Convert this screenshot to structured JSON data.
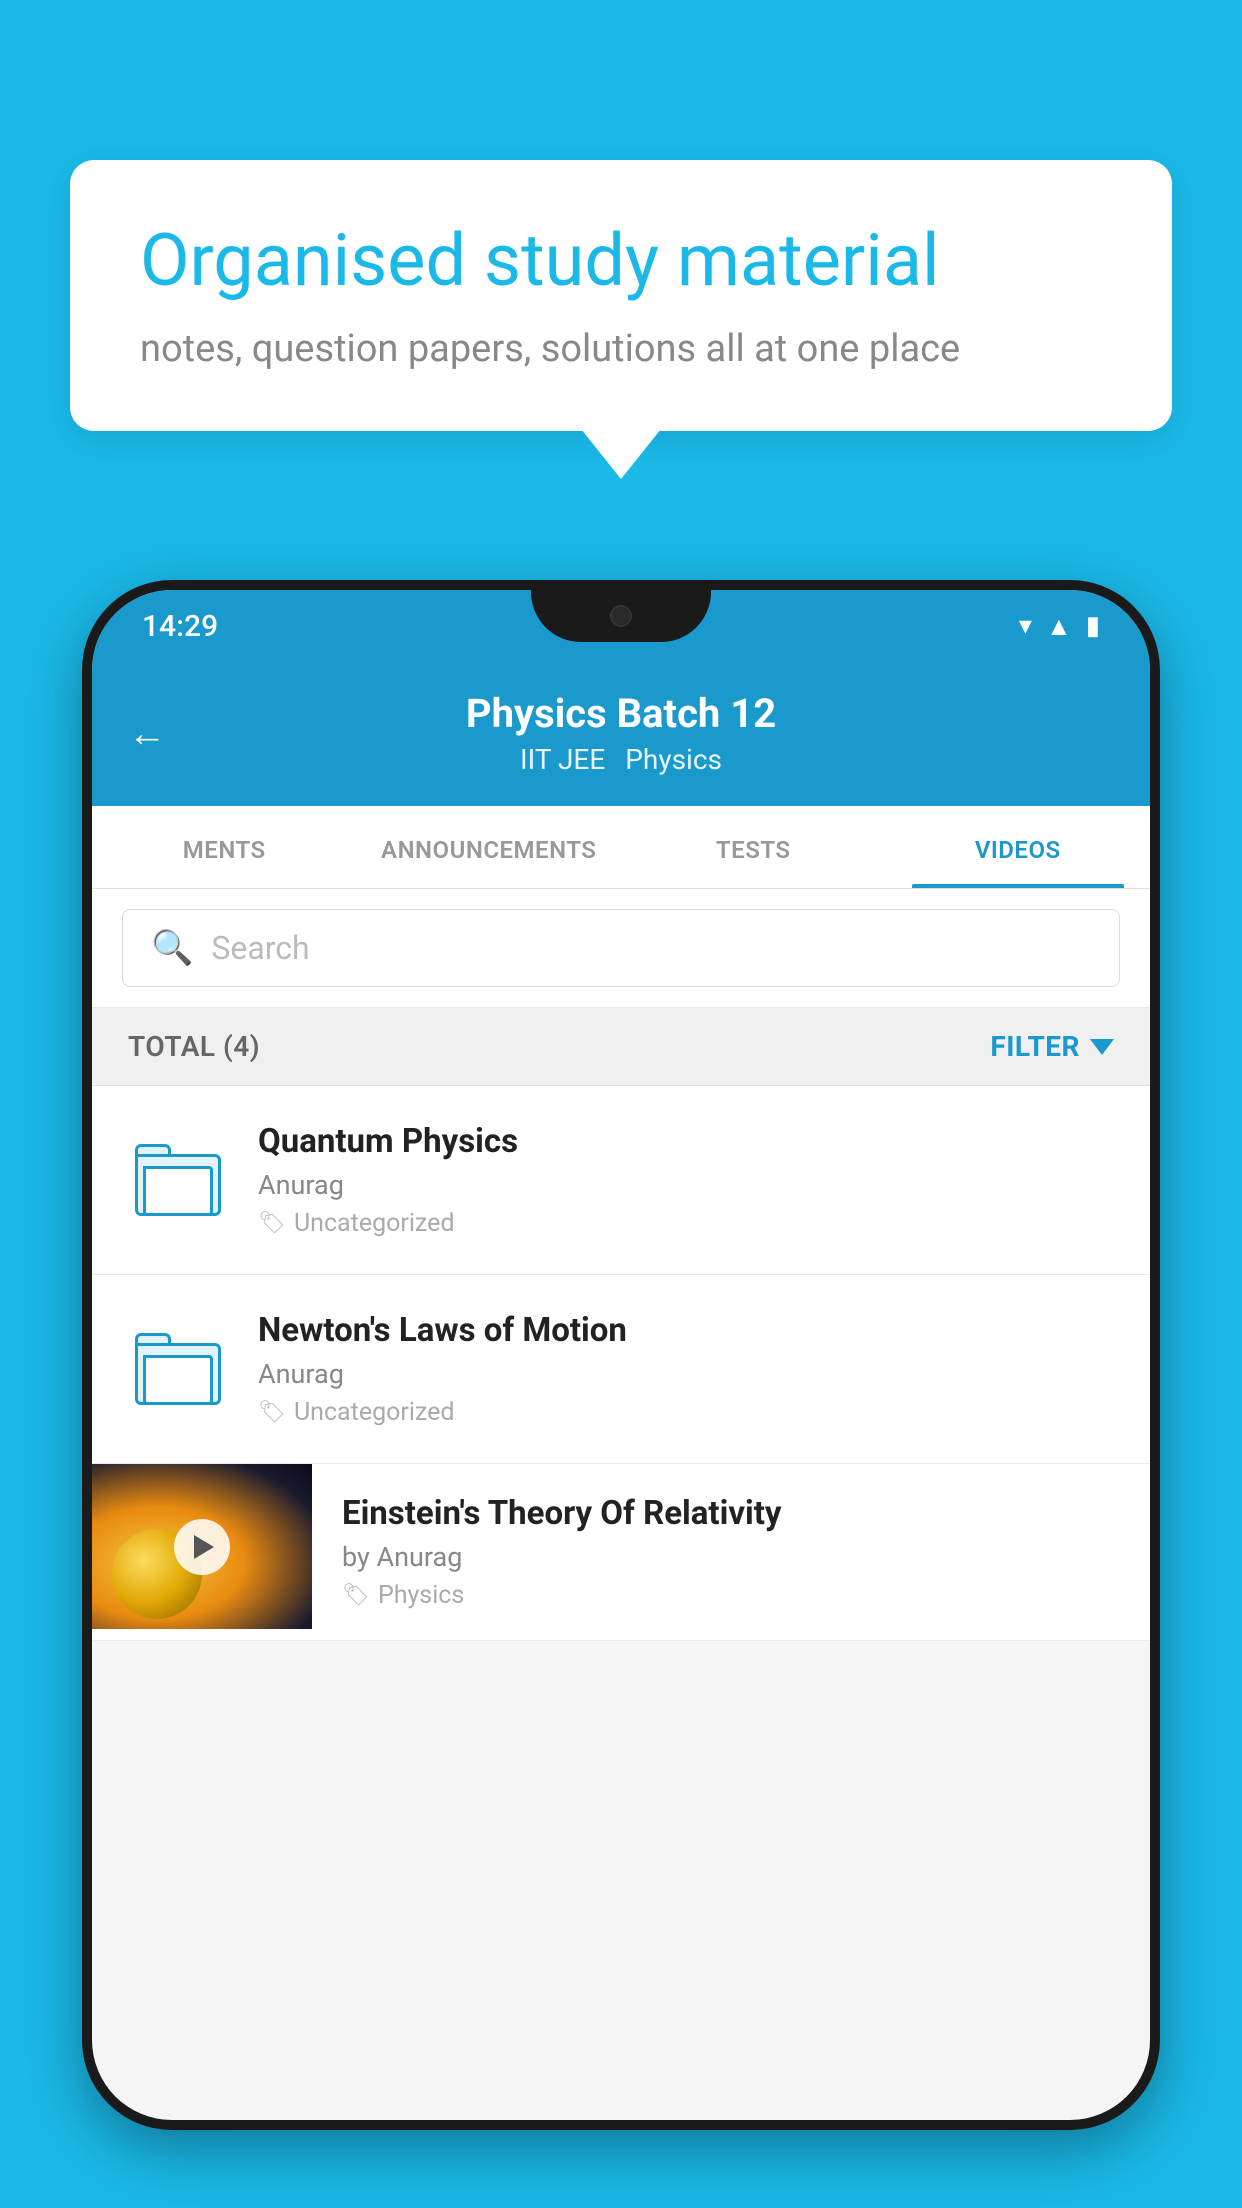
{
  "background_color": "#1ab9e8",
  "speech_bubble": {
    "title": "Organised study material",
    "subtitle": "notes, question papers, solutions all at one place"
  },
  "phone": {
    "status_bar": {
      "time": "14:29",
      "icons": [
        "wifi",
        "signal",
        "battery"
      ]
    },
    "header": {
      "back_label": "←",
      "title": "Physics Batch 12",
      "tags": [
        "IIT JEE",
        "Physics"
      ]
    },
    "tabs": [
      {
        "label": "MENTS",
        "active": false
      },
      {
        "label": "ANNOUNCEMENTS",
        "active": false
      },
      {
        "label": "TESTS",
        "active": false
      },
      {
        "label": "VIDEOS",
        "active": true
      }
    ],
    "search": {
      "placeholder": "Search"
    },
    "filter_bar": {
      "total_label": "TOTAL (4)",
      "filter_label": "FILTER"
    },
    "videos": [
      {
        "title": "Quantum Physics",
        "author": "Anurag",
        "category": "Uncategorized",
        "type": "folder"
      },
      {
        "title": "Newton's Laws of Motion",
        "author": "Anurag",
        "category": "Uncategorized",
        "type": "folder"
      },
      {
        "title": "Einstein's Theory Of Relativity",
        "author": "by Anurag",
        "category": "Physics",
        "type": "video"
      }
    ]
  }
}
